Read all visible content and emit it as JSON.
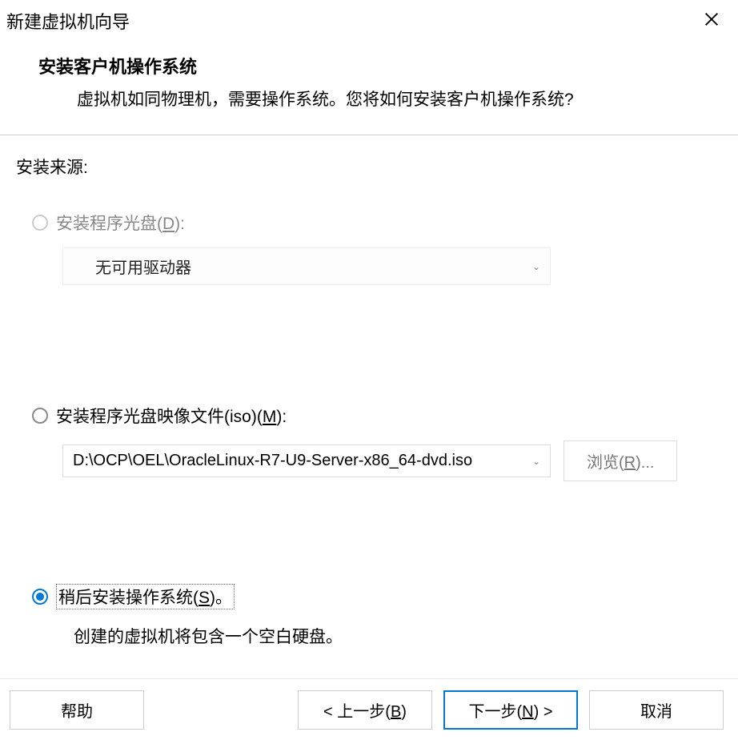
{
  "window": {
    "title": "新建虚拟机向导"
  },
  "header": {
    "heading": "安装客户机操作系统",
    "description": "虚拟机如同物理机，需要操作系统。您将如何安装客户机操作系统?"
  },
  "source": {
    "label": "安装来源:"
  },
  "options": {
    "disc": {
      "label_pre": "安装程序光盘(",
      "hotkey": "D",
      "label_post": "):",
      "dropdown_value": "无可用驱动器"
    },
    "iso": {
      "label_pre": "安装程序光盘映像文件(iso)(",
      "hotkey": "M",
      "label_post": "):",
      "dropdown_value": "D:\\OCP\\OEL\\OracleLinux-R7-U9-Server-x86_64-dvd.iso",
      "browse_pre": "浏览(",
      "browse_hotkey": "R",
      "browse_post": ")..."
    },
    "later": {
      "label_pre": "稍后安装操作系统(",
      "hotkey": "S",
      "label_post": ")。",
      "description": "创建的虚拟机将包含一个空白硬盘。"
    }
  },
  "footer": {
    "help": "帮助",
    "back_pre": "< 上一步(",
    "back_hotkey": "B",
    "back_post": ")",
    "next_pre": "下一步(",
    "next_hotkey": "N",
    "next_post": ") >",
    "cancel": "取消"
  }
}
